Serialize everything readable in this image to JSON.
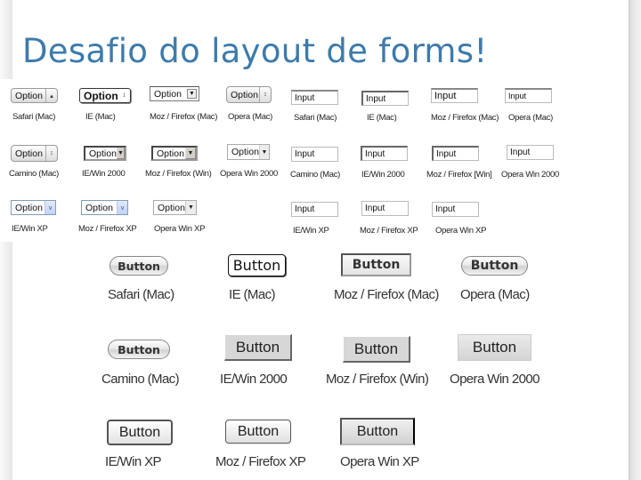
{
  "title": "Desafio do layout de forms!",
  "selects": [
    {
      "label": "Option",
      "caption": "Safari (Mac)",
      "style": "aqua",
      "arrow": "updown"
    },
    {
      "label": "Option",
      "caption": "IE (Mac)",
      "style": "iemac",
      "arrow": "updown"
    },
    {
      "label": "Option",
      "caption": "Moz / Firefox (Mac)",
      "style": "mozmac",
      "arrow": "down"
    },
    {
      "label": "Option",
      "caption": "Opera (Mac)",
      "style": "aqua",
      "arrow": "updown"
    },
    {
      "label": "Option",
      "caption": "Camino (Mac)",
      "style": "aqua",
      "arrow": "updown"
    },
    {
      "label": "Option",
      "caption": "IE/Win 2000",
      "style": "win",
      "arrow": "down"
    },
    {
      "label": "Option",
      "caption": "Moz / Firefox (Win)",
      "style": "win",
      "arrow": "down"
    },
    {
      "label": "Option",
      "caption": "Opera Win 2000",
      "style": "win",
      "arrow": "down"
    },
    {
      "label": "Option",
      "caption": "IE/Win XP",
      "style": "xp",
      "arrow": "chevron"
    },
    {
      "label": "Option",
      "caption": "Moz / Firefox XP",
      "style": "xp",
      "arrow": "chevron"
    },
    {
      "label": "Option",
      "caption": "Opera Win XP",
      "style": "opxp",
      "arrow": "down"
    }
  ],
  "inputs": [
    {
      "value": "Input",
      "caption": "Safari (Mac)"
    },
    {
      "value": "Input",
      "caption": "IE (Mac)"
    },
    {
      "value": "Input",
      "caption": "Moz / Firefox (Mac)"
    },
    {
      "value": "Input",
      "caption": "Opera (Mac)"
    },
    {
      "value": "Input",
      "caption": "Camino (Mac)"
    },
    {
      "value": "Input",
      "caption": "IE/Win 2000"
    },
    {
      "value": "Input",
      "caption": "Moz / Firefox [Win]"
    },
    {
      "value": "Input",
      "caption": "Opera Win 2000"
    },
    {
      "value": "Input",
      "caption": "IE/Win XP"
    },
    {
      "value": "Input",
      "caption": "Moz / Firefox XP"
    },
    {
      "value": "Input",
      "caption": "Opera Win XP"
    }
  ],
  "buttons": [
    {
      "label": "Button",
      "caption": "Safari (Mac)"
    },
    {
      "label": "Button",
      "caption": "IE (Mac)"
    },
    {
      "label": "Button",
      "caption": "Moz / Firefox (Mac)"
    },
    {
      "label": "Button",
      "caption": "Opera (Mac)"
    },
    {
      "label": "Button",
      "caption": "Camino (Mac)"
    },
    {
      "label": "Button",
      "caption": "IE/Win 2000"
    },
    {
      "label": "Button",
      "caption": "Moz / Firefox (Win)"
    },
    {
      "label": "Button",
      "caption": "Opera Win 2000"
    },
    {
      "label": "Button",
      "caption": "IE/Win XP"
    },
    {
      "label": "Button",
      "caption": "Moz / Firefox XP"
    },
    {
      "label": "Button",
      "caption": "Opera Win XP"
    }
  ],
  "icons": {
    "updown": "⬍",
    "down": "▼",
    "chevron": "˅"
  },
  "colors": {
    "title": "#3d7bab"
  }
}
